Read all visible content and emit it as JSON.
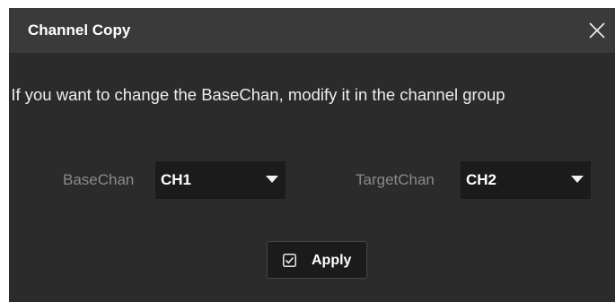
{
  "dialog": {
    "title": "Channel Copy",
    "close_icon": "close-icon",
    "note": "* If you want to change the BaseChan, modify it in the channel group"
  },
  "base": {
    "label": "BaseChan",
    "value": "CH1",
    "arrow_icon": "dropdown-arrow-icon"
  },
  "target": {
    "label": "TargetChan",
    "value": "CH2",
    "arrow_icon": "dropdown-arrow-icon"
  },
  "apply": {
    "label": "Apply",
    "checked": true,
    "check_icon": "checkbox-checked-icon"
  },
  "colors": {
    "dialog_background": "#2b2b2b",
    "titlebar_background": "#3a3a3a",
    "field_background": "#1b1b1b",
    "label_text": "#8a8a8a",
    "primary_text": "#ffffff"
  }
}
